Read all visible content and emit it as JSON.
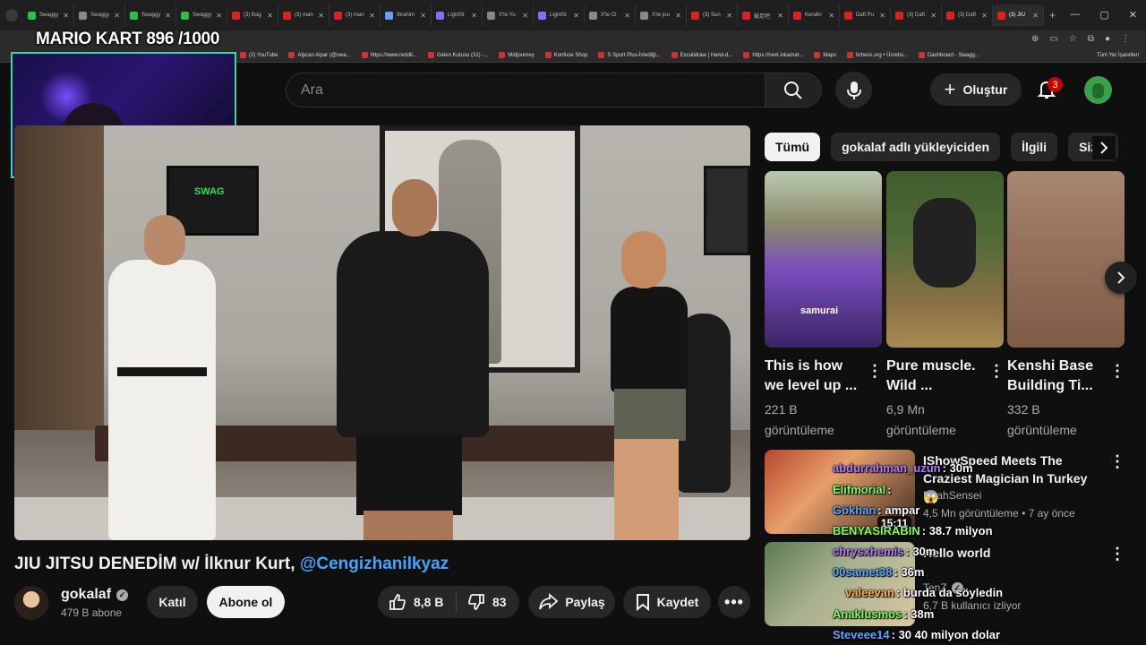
{
  "browser": {
    "tabs": [
      {
        "label": "Swaggy",
        "color": "#2bbf4a"
      },
      {
        "label": "Swaggy",
        "color": "#888888"
      },
      {
        "label": "Swaggy",
        "color": "#2bbf4a"
      },
      {
        "label": "Swaggy",
        "color": "#2bbf4a"
      },
      {
        "label": "(3) Bag",
        "color": "#e02020"
      },
      {
        "label": "(3) man",
        "color": "#e02020"
      },
      {
        "label": "(3) man",
        "color": "#e02020"
      },
      {
        "label": "İbrahim",
        "color": "#6a9cff"
      },
      {
        "label": "LightSt",
        "color": "#8a6aff"
      },
      {
        "label": "X'te Yu",
        "color": "#888888"
      },
      {
        "label": "LightSt",
        "color": "#8a6aff"
      },
      {
        "label": "X'te Cl",
        "color": "#888888"
      },
      {
        "label": "X'te jou",
        "color": "#888888"
      },
      {
        "label": "(3) Sun",
        "color": "#e02020"
      },
      {
        "label": "鼓足吧",
        "color": "#e02020"
      },
      {
        "label": "Kendin",
        "color": "#e02020"
      },
      {
        "label": "Daft Pu",
        "color": "#e02020"
      },
      {
        "label": "(3) Daft",
        "color": "#e02020"
      },
      {
        "label": "(3) Daft",
        "color": "#e02020"
      },
      {
        "label": "(3) JIU",
        "color": "#e02020",
        "active": true
      }
    ],
    "bookmarks": [
      "(2) YouTube",
      "Alpcan Alpar (@swa...",
      "https://www.reddit...",
      "Gelen Kutusu (31) -...",
      "Midjourney",
      "Konfuse Shop",
      "S Sport Plus-İstediği...",
      "Excalidraw | Hand-d...",
      "https://next.inkamat...",
      "Maps",
      "lichess.org • Ücretsi...",
      "Dashboard - Swagg..."
    ],
    "all_bookmarks": "Tüm Yer İşaretleri"
  },
  "overlay": {
    "title": "MARIO KART  896 /1000"
  },
  "header": {
    "search_placeholder": "Ara",
    "create_label": "Oluştur",
    "notifications_count": "3"
  },
  "video": {
    "title": "JIU JITSU DENEDİM w/ İlknur Kurt, ",
    "mention": "@Cengizhanilkyaz",
    "tv_sign": "SWAG"
  },
  "channel": {
    "name": "gokalaf",
    "subscribers": "479 B abone",
    "join_label": "Katıl",
    "subscribe_label": "Abone ol"
  },
  "actions": {
    "likes": "8,8 B",
    "dislikes": "83",
    "share_label": "Paylaş",
    "save_label": "Kaydet"
  },
  "chips": [
    "Tümü",
    "gokalaf adlı yükleyiciden",
    "İlgili",
    "Size"
  ],
  "shorts": [
    {
      "title": "This is how we level up ...",
      "views": "221 B görüntüleme",
      "tag": "samurai"
    },
    {
      "title": "Pure muscle. Wild ...",
      "views": "6,9 Mn görüntüleme"
    },
    {
      "title": "Kenshi Base Building Ti...",
      "views": "332 B görüntüleme"
    }
  ],
  "recommendations": [
    {
      "title": "IShowSpeed Meets The Craziest Magician In Turkey 😱",
      "channel": "NoahSensei",
      "meta": "4,5 Mn görüntüleme • 7 ay önce",
      "duration": "15:11"
    },
    {
      "title": "Hello world",
      "channel": "TenZ",
      "meta": "6,7 B kullanıcı izliyor",
      "duration": ""
    }
  ],
  "chat": [
    {
      "user": "abdurrahman_uzun",
      "msg": ": 30m",
      "color": "#b27aff"
    },
    {
      "user": "Elifmorial",
      "msg": ":",
      "color": "#7cff5a"
    },
    {
      "user": "Gökhan",
      "msg": ": ampar",
      "color": "#5aa8ff"
    },
    {
      "user": "BENYASIRABIN",
      "msg": ": 38.7 milyon",
      "color": "#7cff5a"
    },
    {
      "user": "chrysxhemis",
      "msg": ": 30m",
      "color": "#b27aff"
    },
    {
      "user": "00samet38",
      "msg": ": 36m",
      "color": "#5aa8ff"
    },
    {
      "user": "valeevan",
      "msg": ": burda da söyledin",
      "color": "#ffb347"
    },
    {
      "user": "Anaklusmos",
      "msg": ": 38m",
      "color": "#7cff5a"
    },
    {
      "user": "Steveee14",
      "msg": ": 30 40 milyon dolar",
      "color": "#5aa8ff"
    }
  ]
}
